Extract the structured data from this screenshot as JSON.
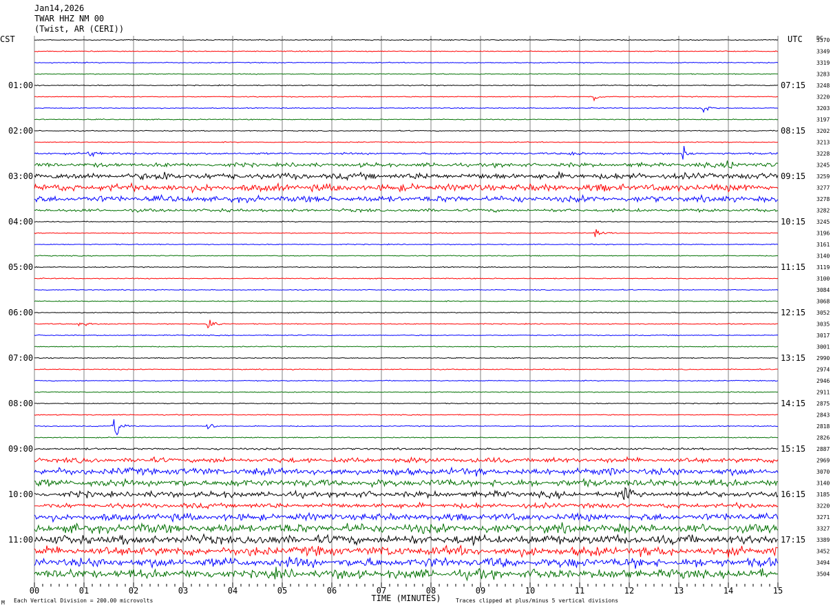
{
  "header": {
    "date": "Jan14,2026",
    "station": "TWAR HHZ NM 00",
    "location": "(Twist, AR (CERI))"
  },
  "left_zone_label": "CST",
  "right_zone_label": "UTC",
  "dc_label": "DC",
  "footer": {
    "scale_note": "Each Vertical Division =  200.00 microvolts",
    "clip_note": "Traces clipped at plus/minus 5 vertical divisions",
    "corner_mark": "M"
  },
  "colors": {
    "trace_cycle": [
      "#000000",
      "#ff0000",
      "#0000ff",
      "#007000"
    ],
    "grid": "#808080"
  },
  "chart_data": {
    "type": "helicorder",
    "xlabel": "TIME (MINUTES)",
    "x_ticks": [
      "00",
      "01",
      "02",
      "03",
      "04",
      "05",
      "06",
      "07",
      "08",
      "09",
      "10",
      "11",
      "12",
      "13",
      "14",
      "15"
    ],
    "xlim": [
      0,
      15
    ],
    "row_minutes": 15,
    "rows": 48,
    "left_time_labels": [
      {
        "row": 4,
        "label": "01:00"
      },
      {
        "row": 8,
        "label": "02:00"
      },
      {
        "row": 12,
        "label": "03:00"
      },
      {
        "row": 16,
        "label": "04:00"
      },
      {
        "row": 20,
        "label": "05:00"
      },
      {
        "row": 24,
        "label": "06:00"
      },
      {
        "row": 28,
        "label": "07:00"
      },
      {
        "row": 32,
        "label": "08:00"
      },
      {
        "row": 36,
        "label": "09:00"
      },
      {
        "row": 40,
        "label": "10:00"
      },
      {
        "row": 44,
        "label": "11:00"
      }
    ],
    "right_time_labels": [
      {
        "row": 4,
        "label": "07:15"
      },
      {
        "row": 8,
        "label": "08:15"
      },
      {
        "row": 12,
        "label": "09:15"
      },
      {
        "row": 16,
        "label": "10:15"
      },
      {
        "row": 20,
        "label": "11:15"
      },
      {
        "row": 24,
        "label": "12:15"
      },
      {
        "row": 28,
        "label": "13:15"
      },
      {
        "row": 32,
        "label": "14:15"
      },
      {
        "row": 36,
        "label": "15:15"
      },
      {
        "row": 40,
        "label": "16:15"
      },
      {
        "row": 44,
        "label": "17:15"
      }
    ],
    "dc_offsets": [
      "3370",
      "3349",
      "3319",
      "3283",
      "3248",
      "3220",
      "3203",
      "3197",
      "3202",
      "3213",
      "3228",
      "3245",
      "3259",
      "3277",
      "3278",
      "3282",
      "3245",
      "3196",
      "3161",
      "3140",
      "3119",
      "3100",
      "3084",
      "3068",
      "3052",
      "3035",
      "3017",
      "3001",
      "2990",
      "2974",
      "2946",
      "2911",
      "2875",
      "2843",
      "2818",
      "2826",
      "2887",
      "2969",
      "3070",
      "3140",
      "3185",
      "3220",
      "3271",
      "3327",
      "3389",
      "3452",
      "3494",
      "3504"
    ],
    "noise_level": [
      1,
      1,
      1,
      1,
      1,
      1,
      1,
      1,
      1,
      1,
      2,
      4,
      6,
      7,
      6,
      3,
      1,
      1,
      1,
      1,
      1,
      1,
      1,
      1,
      1,
      1,
      1,
      1,
      1,
      1,
      1,
      1,
      1,
      1,
      1,
      1,
      2,
      5,
      7,
      7,
      6,
      5,
      7,
      9,
      9,
      9,
      9,
      9
    ],
    "events": [
      {
        "row": 6,
        "minute": 13.5,
        "amp": 6
      },
      {
        "row": 5,
        "minute": 11.3,
        "amp": 4
      },
      {
        "row": 10,
        "minute": 1.1,
        "amp": 5
      },
      {
        "row": 10,
        "minute": 13.1,
        "amp": 8
      },
      {
        "row": 10,
        "minute": 10.8,
        "amp": 6
      },
      {
        "row": 11,
        "minute": 14.0,
        "amp": 10
      },
      {
        "row": 12,
        "minute": 2.6,
        "amp": 9
      },
      {
        "row": 17,
        "minute": 11.3,
        "amp": 6
      },
      {
        "row": 25,
        "minute": 3.5,
        "amp": 10
      },
      {
        "row": 25,
        "minute": 0.9,
        "amp": 5
      },
      {
        "row": 34,
        "minute": 1.6,
        "amp": 16
      },
      {
        "row": 34,
        "minute": 3.5,
        "amp": 5
      },
      {
        "row": 40,
        "minute": 11.9,
        "amp": 8
      }
    ]
  }
}
